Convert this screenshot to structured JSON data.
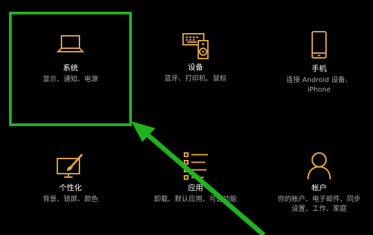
{
  "accent_color": "#e3a33c",
  "highlight_color": "#1fb31f",
  "tiles": {
    "system": {
      "title": "系统",
      "desc": "显示、通知、电源",
      "icon": "laptop-icon"
    },
    "devices": {
      "title": "设备",
      "desc": "蓝牙、打印机、鼠标",
      "icon": "keyboard-speaker-icon"
    },
    "phone": {
      "title": "手机",
      "desc": "连接 Android 设备、",
      "desc2": "iPhone",
      "icon": "phone-icon"
    },
    "personalization": {
      "title": "个性化",
      "desc": "背景、锁屏、颜色",
      "icon": "paint-monitor-icon"
    },
    "apps": {
      "title": "应用",
      "desc": "卸载、默认应用、可选功能",
      "icon": "apps-list-icon"
    },
    "accounts": {
      "title": "帐户",
      "desc": "你的帐户、电子邮件、同步",
      "desc2": "设置、工作、家庭",
      "icon": "person-icon"
    }
  }
}
